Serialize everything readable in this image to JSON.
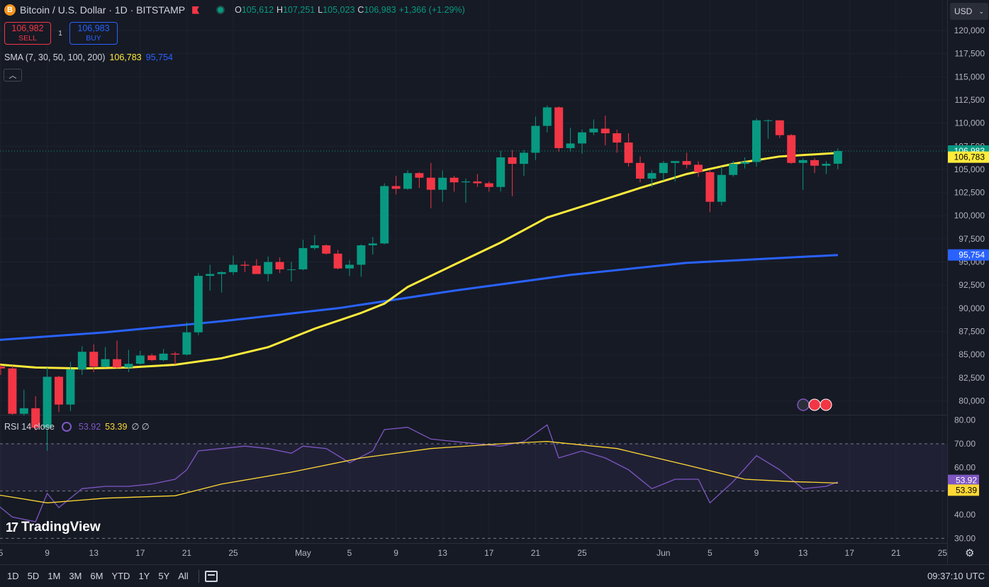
{
  "header": {
    "symbol_icon": "B",
    "title": "Bitcoin / U.S. Dollar · 1D · BITSTAMP",
    "ohlc": [
      {
        "k": "O",
        "v": "105,612"
      },
      {
        "k": "H",
        "v": "107,251"
      },
      {
        "k": "L",
        "v": "105,023"
      },
      {
        "k": "C",
        "v": "106,983"
      },
      {
        "k": "",
        "v": "+1,366 (+1.29%)"
      }
    ]
  },
  "trade": {
    "sell_price": "106,982",
    "sell_label": "SELL",
    "spread": "1",
    "buy_price": "106,983",
    "buy_label": "BUY"
  },
  "sma": {
    "label": "SMA (7, 30, 50, 100, 200)",
    "value1": "106,783",
    "value2": "95,754"
  },
  "rsi": {
    "label": "RSI 14 close",
    "value": "53.92",
    "ma": "53.39",
    "extra": "∅ ∅"
  },
  "currency": "USD",
  "brand": "TradingView",
  "ranges": [
    "1D",
    "5D",
    "1M",
    "3M",
    "6M",
    "YTD",
    "1Y",
    "5Y",
    "All"
  ],
  "clock": "09:37:10 UTC",
  "colors": {
    "bg": "#161a25",
    "up": "#089981",
    "down": "#f23645",
    "sma_fast": "#ffeb3b",
    "sma_slow": "#2962ff",
    "rsi": "#7e57c2",
    "rsi_ma": "#fdd835"
  },
  "chart_data": {
    "type": "candlestick",
    "price_axis": {
      "range": [
        78500,
        121000
      ],
      "ticks": [
        "120,000",
        "117,500",
        "115,000",
        "112,500",
        "110,000",
        "107,500",
        "105,000",
        "102,500",
        "100,000",
        "97,500",
        "95,000",
        "92,500",
        "90,000",
        "87,500",
        "85,000",
        "82,500",
        "80,000"
      ],
      "tick_values": [
        120000,
        117500,
        115000,
        112500,
        110000,
        107500,
        105000,
        102500,
        100000,
        97500,
        95000,
        92500,
        90000,
        87500,
        85000,
        82500,
        80000
      ],
      "last_price": "106,983",
      "sma_label": "106,783",
      "sma_slow_label": "95,754"
    },
    "x_axis": {
      "labels": [
        "5",
        "9",
        "13",
        "17",
        "21",
        "25",
        "May",
        "5",
        "9",
        "13",
        "17",
        "21",
        "25",
        "Jun",
        "5",
        "9",
        "13",
        "17",
        "21",
        "25"
      ],
      "label_dates": [
        "2025-04-05",
        "2025-04-09",
        "2025-04-13",
        "2025-04-17",
        "2025-04-21",
        "2025-04-25",
        "2025-05-01",
        "2025-05-05",
        "2025-05-09",
        "2025-05-13",
        "2025-05-17",
        "2025-05-21",
        "2025-05-25",
        "2025-06-01",
        "2025-06-05",
        "2025-06-09",
        "2025-06-13",
        "2025-06-17",
        "2025-06-21",
        "2025-06-25"
      ],
      "first_date": "2025-04-05"
    },
    "candles": [
      {
        "date": "2025-04-05",
        "o": 83700,
        "h": 83900,
        "l": 82800,
        "c": 83500
      },
      {
        "date": "2025-04-06",
        "o": 83500,
        "h": 83800,
        "l": 78500,
        "c": 78600
      },
      {
        "date": "2025-04-07",
        "o": 78600,
        "h": 81200,
        "l": 78400,
        "c": 79200
      },
      {
        "date": "2025-04-08",
        "o": 79200,
        "h": 80500,
        "l": 76800,
        "c": 77100
      },
      {
        "date": "2025-04-09",
        "o": 77100,
        "h": 83600,
        "l": 74600,
        "c": 82600
      },
      {
        "date": "2025-04-10",
        "o": 82600,
        "h": 82700,
        "l": 78800,
        "c": 79600
      },
      {
        "date": "2025-04-11",
        "o": 79600,
        "h": 84200,
        "l": 78900,
        "c": 83400
      },
      {
        "date": "2025-04-12",
        "o": 83400,
        "h": 85900,
        "l": 82800,
        "c": 85300
      },
      {
        "date": "2025-04-13",
        "o": 85300,
        "h": 86100,
        "l": 83100,
        "c": 83700
      },
      {
        "date": "2025-04-14",
        "o": 83700,
        "h": 85800,
        "l": 83600,
        "c": 84500
      },
      {
        "date": "2025-04-15",
        "o": 84500,
        "h": 86500,
        "l": 83500,
        "c": 83600
      },
      {
        "date": "2025-04-16",
        "o": 83600,
        "h": 85500,
        "l": 83100,
        "c": 84000
      },
      {
        "date": "2025-04-17",
        "o": 84000,
        "h": 85400,
        "l": 83900,
        "c": 84900
      },
      {
        "date": "2025-04-18",
        "o": 84900,
        "h": 85100,
        "l": 84300,
        "c": 84400
      },
      {
        "date": "2025-04-19",
        "o": 84400,
        "h": 85600,
        "l": 84300,
        "c": 85100
      },
      {
        "date": "2025-04-20",
        "o": 85100,
        "h": 85300,
        "l": 83900,
        "c": 85000
      },
      {
        "date": "2025-04-21",
        "o": 85000,
        "h": 88500,
        "l": 84900,
        "c": 87400
      },
      {
        "date": "2025-04-22",
        "o": 87400,
        "h": 93800,
        "l": 87100,
        "c": 93500
      },
      {
        "date": "2025-04-23",
        "o": 93500,
        "h": 94700,
        "l": 91900,
        "c": 93700
      },
      {
        "date": "2025-04-24",
        "o": 93700,
        "h": 94000,
        "l": 91700,
        "c": 93900
      },
      {
        "date": "2025-04-25",
        "o": 93900,
        "h": 95700,
        "l": 93600,
        "c": 94700
      },
      {
        "date": "2025-04-26",
        "o": 94700,
        "h": 95100,
        "l": 93900,
        "c": 94600
      },
      {
        "date": "2025-04-27",
        "o": 94600,
        "h": 95300,
        "l": 93700,
        "c": 93700
      },
      {
        "date": "2025-04-28",
        "o": 93700,
        "h": 95600,
        "l": 92900,
        "c": 95000
      },
      {
        "date": "2025-04-29",
        "o": 95000,
        "h": 95500,
        "l": 93800,
        "c": 94200
      },
      {
        "date": "2025-04-30",
        "o": 94200,
        "h": 95000,
        "l": 92900,
        "c": 94200
      },
      {
        "date": "2025-05-01",
        "o": 94200,
        "h": 97400,
        "l": 94100,
        "c": 96500
      },
      {
        "date": "2025-05-02",
        "o": 96500,
        "h": 97900,
        "l": 96300,
        "c": 96800
      },
      {
        "date": "2025-05-03",
        "o": 96800,
        "h": 96900,
        "l": 95800,
        "c": 95900
      },
      {
        "date": "2025-05-04",
        "o": 95900,
        "h": 96300,
        "l": 94200,
        "c": 94300
      },
      {
        "date": "2025-05-05",
        "o": 94300,
        "h": 95200,
        "l": 93500,
        "c": 94700
      },
      {
        "date": "2025-05-06",
        "o": 94700,
        "h": 96900,
        "l": 93400,
        "c": 96800
      },
      {
        "date": "2025-05-07",
        "o": 96800,
        "h": 97700,
        "l": 95800,
        "c": 97000
      },
      {
        "date": "2025-05-08",
        "o": 97000,
        "h": 103500,
        "l": 96900,
        "c": 103200
      },
      {
        "date": "2025-05-09",
        "o": 103200,
        "h": 104300,
        "l": 102300,
        "c": 102900
      },
      {
        "date": "2025-05-10",
        "o": 102900,
        "h": 104900,
        "l": 102800,
        "c": 104600
      },
      {
        "date": "2025-05-11",
        "o": 104600,
        "h": 104700,
        "l": 103000,
        "c": 104100
      },
      {
        "date": "2025-05-12",
        "o": 104100,
        "h": 105700,
        "l": 100800,
        "c": 102800
      },
      {
        "date": "2025-05-13",
        "o": 102800,
        "h": 104900,
        "l": 101500,
        "c": 104100
      },
      {
        "date": "2025-05-14",
        "o": 104100,
        "h": 104300,
        "l": 102600,
        "c": 103600
      },
      {
        "date": "2025-05-15",
        "o": 103600,
        "h": 104000,
        "l": 101400,
        "c": 103700
      },
      {
        "date": "2025-05-16",
        "o": 103700,
        "h": 104500,
        "l": 103100,
        "c": 103500
      },
      {
        "date": "2025-05-17",
        "o": 103500,
        "h": 103700,
        "l": 102600,
        "c": 103100
      },
      {
        "date": "2025-05-18",
        "o": 103100,
        "h": 107000,
        "l": 102600,
        "c": 106300
      },
      {
        "date": "2025-05-19",
        "o": 106300,
        "h": 107100,
        "l": 102100,
        "c": 105600
      },
      {
        "date": "2025-05-20",
        "o": 105600,
        "h": 107100,
        "l": 104300,
        "c": 106800
      },
      {
        "date": "2025-05-21",
        "o": 106800,
        "h": 110700,
        "l": 106000,
        "c": 109700
      },
      {
        "date": "2025-05-22",
        "o": 109700,
        "h": 111900,
        "l": 109000,
        "c": 111700
      },
      {
        "date": "2025-05-23",
        "o": 111700,
        "h": 111800,
        "l": 106900,
        "c": 107300
      },
      {
        "date": "2025-05-24",
        "o": 107300,
        "h": 109500,
        "l": 106900,
        "c": 107800
      },
      {
        "date": "2025-05-25",
        "o": 107800,
        "h": 109300,
        "l": 106700,
        "c": 109000
      },
      {
        "date": "2025-05-26",
        "o": 109000,
        "h": 110400,
        "l": 108700,
        "c": 109400
      },
      {
        "date": "2025-05-27",
        "o": 109400,
        "h": 110800,
        "l": 107600,
        "c": 108900
      },
      {
        "date": "2025-05-28",
        "o": 108900,
        "h": 109300,
        "l": 106800,
        "c": 107900
      },
      {
        "date": "2025-05-29",
        "o": 107900,
        "h": 108900,
        "l": 105300,
        "c": 105700
      },
      {
        "date": "2025-05-30",
        "o": 105700,
        "h": 106400,
        "l": 103600,
        "c": 104000
      },
      {
        "date": "2025-05-31",
        "o": 104000,
        "h": 104900,
        "l": 103100,
        "c": 104600
      },
      {
        "date": "2025-06-01",
        "o": 104600,
        "h": 105900,
        "l": 103800,
        "c": 105700
      },
      {
        "date": "2025-06-02",
        "o": 105700,
        "h": 105900,
        "l": 103700,
        "c": 105900
      },
      {
        "date": "2025-06-03",
        "o": 105900,
        "h": 106800,
        "l": 105100,
        "c": 105500
      },
      {
        "date": "2025-06-04",
        "o": 105500,
        "h": 105900,
        "l": 104200,
        "c": 104700
      },
      {
        "date": "2025-06-05",
        "o": 104700,
        "h": 105000,
        "l": 100400,
        "c": 101500
      },
      {
        "date": "2025-06-06",
        "o": 101500,
        "h": 105300,
        "l": 101100,
        "c": 104400
      },
      {
        "date": "2025-06-07",
        "o": 104400,
        "h": 105900,
        "l": 104200,
        "c": 105600
      },
      {
        "date": "2025-06-08",
        "o": 105600,
        "h": 106300,
        "l": 105100,
        "c": 105800
      },
      {
        "date": "2025-06-09",
        "o": 105800,
        "h": 110500,
        "l": 105300,
        "c": 110300
      },
      {
        "date": "2025-06-10",
        "o": 110300,
        "h": 110400,
        "l": 108300,
        "c": 110300
      },
      {
        "date": "2025-06-11",
        "o": 110300,
        "h": 110300,
        "l": 108400,
        "c": 108700
      },
      {
        "date": "2025-06-12",
        "o": 108700,
        "h": 108800,
        "l": 105600,
        "c": 105700
      },
      {
        "date": "2025-06-13",
        "o": 105700,
        "h": 106200,
        "l": 102800,
        "c": 106000
      },
      {
        "date": "2025-06-14",
        "o": 106000,
        "h": 106200,
        "l": 104600,
        "c": 105400
      },
      {
        "date": "2025-06-15",
        "o": 105400,
        "h": 105900,
        "l": 104500,
        "c": 105600
      },
      {
        "date": "2025-06-16",
        "o": 105612,
        "h": 107251,
        "l": 105023,
        "c": 106983
      }
    ],
    "sma_fast": [
      [
        "2025-04-04",
        84000
      ],
      [
        "2025-04-08",
        83600
      ],
      [
        "2025-04-12",
        83500
      ],
      [
        "2025-04-16",
        83600
      ],
      [
        "2025-04-20",
        83900
      ],
      [
        "2025-04-24",
        84600
      ],
      [
        "2025-04-28",
        85800
      ],
      [
        "2025-05-02",
        87800
      ],
      [
        "2025-05-06",
        89500
      ],
      [
        "2025-05-08",
        90500
      ],
      [
        "2025-05-10",
        92300
      ],
      [
        "2025-05-14",
        94700
      ],
      [
        "2025-05-18",
        97100
      ],
      [
        "2025-05-22",
        99800
      ],
      [
        "2025-05-26",
        101400
      ],
      [
        "2025-05-30",
        103000
      ],
      [
        "2025-06-03",
        104500
      ],
      [
        "2025-06-07",
        105600
      ],
      [
        "2025-06-11",
        106400
      ],
      [
        "2025-06-16",
        106783
      ]
    ],
    "sma_slow": [
      [
        "2025-04-04",
        86500
      ],
      [
        "2025-04-14",
        87400
      ],
      [
        "2025-04-24",
        88600
      ],
      [
        "2025-05-04",
        90000
      ],
      [
        "2025-05-14",
        91900
      ],
      [
        "2025-05-24",
        93600
      ],
      [
        "2025-06-03",
        94900
      ],
      [
        "2025-06-16",
        95754
      ]
    ],
    "rsi_axis": {
      "range": [
        28,
        82
      ],
      "ticks": [
        "80.00",
        "70.00",
        "60.00",
        "50.00",
        "40.00",
        "30.00"
      ],
      "tick_values": [
        80,
        70,
        60,
        50,
        40,
        30
      ],
      "band": [
        50,
        70
      ],
      "last": "53.92",
      "ma_last": "53.39"
    },
    "rsi": [
      [
        "2025-04-04",
        47
      ],
      [
        "2025-04-06",
        39
      ],
      [
        "2025-04-08",
        37
      ],
      [
        "2025-04-09",
        49
      ],
      [
        "2025-04-10",
        43
      ],
      [
        "2025-04-12",
        51
      ],
      [
        "2025-04-14",
        52
      ],
      [
        "2025-04-16",
        52
      ],
      [
        "2025-04-18",
        53
      ],
      [
        "2025-04-20",
        55
      ],
      [
        "2025-04-21",
        59
      ],
      [
        "2025-04-22",
        67
      ],
      [
        "2025-04-24",
        68
      ],
      [
        "2025-04-26",
        69
      ],
      [
        "2025-04-28",
        68
      ],
      [
        "2025-04-30",
        66
      ],
      [
        "2025-05-01",
        69
      ],
      [
        "2025-05-03",
        68
      ],
      [
        "2025-05-05",
        62
      ],
      [
        "2025-05-07",
        67
      ],
      [
        "2025-05-08",
        76
      ],
      [
        "2025-05-10",
        77
      ],
      [
        "2025-05-12",
        72
      ],
      [
        "2025-05-14",
        71
      ],
      [
        "2025-05-16",
        70
      ],
      [
        "2025-05-18",
        69
      ],
      [
        "2025-05-20",
        71
      ],
      [
        "2025-05-22",
        78
      ],
      [
        "2025-05-23",
        64
      ],
      [
        "2025-05-25",
        67
      ],
      [
        "2025-05-27",
        64
      ],
      [
        "2025-05-29",
        59
      ],
      [
        "2025-05-31",
        51
      ],
      [
        "2025-06-02",
        55
      ],
      [
        "2025-06-04",
        55
      ],
      [
        "2025-06-05",
        45
      ],
      [
        "2025-06-07",
        54
      ],
      [
        "2025-06-09",
        65
      ],
      [
        "2025-06-11",
        59
      ],
      [
        "2025-06-13",
        51
      ],
      [
        "2025-06-15",
        52
      ],
      [
        "2025-06-16",
        53.92
      ]
    ],
    "rsi_ma": [
      [
        "2025-04-04",
        49
      ],
      [
        "2025-04-09",
        45
      ],
      [
        "2025-04-14",
        47
      ],
      [
        "2025-04-20",
        48
      ],
      [
        "2025-04-24",
        53
      ],
      [
        "2025-04-30",
        58
      ],
      [
        "2025-05-06",
        64
      ],
      [
        "2025-05-12",
        68
      ],
      [
        "2025-05-18",
        70
      ],
      [
        "2025-05-22",
        71
      ],
      [
        "2025-05-28",
        68
      ],
      [
        "2025-06-03",
        61
      ],
      [
        "2025-06-08",
        55
      ],
      [
        "2025-06-12",
        54
      ],
      [
        "2025-06-16",
        53.39
      ]
    ]
  }
}
